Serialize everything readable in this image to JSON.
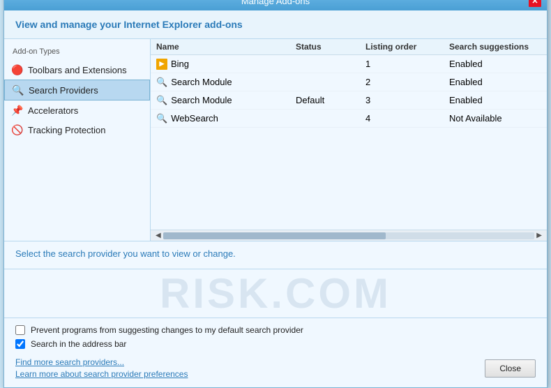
{
  "window": {
    "title": "Manage Add-ons",
    "close_btn_label": "✕"
  },
  "header": {
    "banner": "View and manage your Internet Explorer add-ons"
  },
  "sidebar": {
    "label": "Add-on Types",
    "items": [
      {
        "id": "toolbars",
        "label": "Toolbars and Extensions",
        "icon": "🔴"
      },
      {
        "id": "search",
        "label": "Search Providers",
        "icon": "🔍"
      },
      {
        "id": "accelerators",
        "label": "Accelerators",
        "icon": "📌"
      },
      {
        "id": "tracking",
        "label": "Tracking Protection",
        "icon": "🚫"
      }
    ]
  },
  "table": {
    "headers": {
      "name": "Name",
      "status": "Status",
      "listing_order": "Listing order",
      "search_suggestions": "Search suggestions"
    },
    "rows": [
      {
        "name": "Bing",
        "icon_type": "bing",
        "status": "",
        "listing_order": "1",
        "search_suggestions": "Enabled"
      },
      {
        "name": "Search Module",
        "icon_type": "search",
        "status": "",
        "listing_order": "2",
        "search_suggestions": "Enabled"
      },
      {
        "name": "Search Module",
        "icon_type": "search",
        "status": "Default",
        "listing_order": "3",
        "search_suggestions": "Enabled"
      },
      {
        "name": "WebSearch",
        "icon_type": "search",
        "status": "",
        "listing_order": "4",
        "search_suggestions": "Not Available"
      }
    ]
  },
  "bottom_instruction": "Select the search provider you want to view or change.",
  "watermark_text": "RISK.COM",
  "checkboxes": [
    {
      "id": "prevent",
      "label": "Prevent programs from suggesting changes to my default search provider",
      "checked": false
    },
    {
      "id": "address",
      "label": "Search in the address bar",
      "checked": true
    }
  ],
  "footer": {
    "links": [
      {
        "label": "Find more search providers..."
      },
      {
        "label": "Learn more about search provider preferences"
      }
    ],
    "close_button": "Close"
  }
}
